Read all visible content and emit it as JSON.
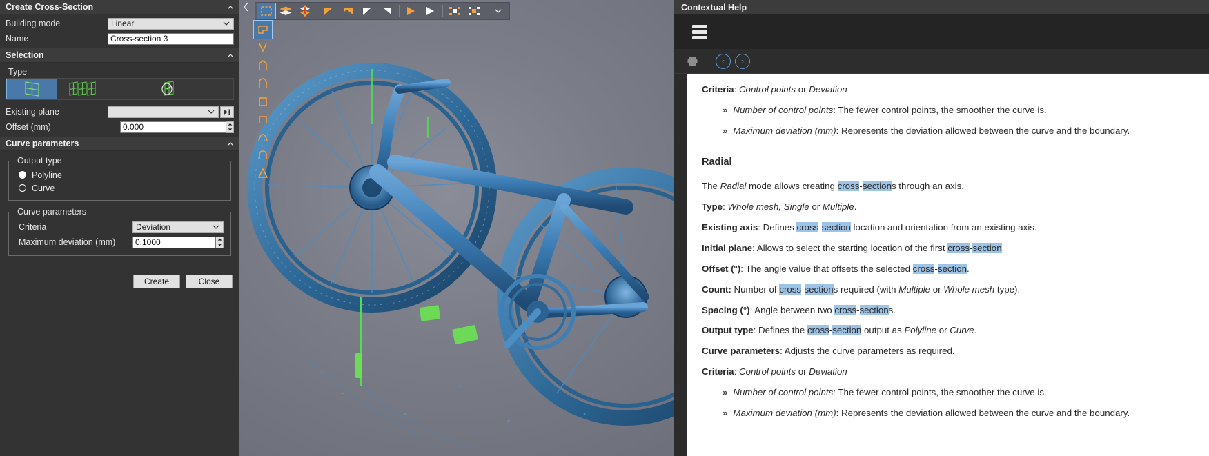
{
  "left_panel": {
    "title": "Create Cross-Section",
    "collapse_icon": "chevron-up-icon",
    "building_mode": {
      "label": "Building mode",
      "value": "Linear"
    },
    "name": {
      "label": "Name",
      "value": "Cross-section 3"
    },
    "selection": {
      "title": "Selection",
      "type_label": "Type"
    },
    "type_buttons": [
      {
        "name": "single-plane",
        "selected": true
      },
      {
        "name": "multiple-planes",
        "selected": false
      },
      {
        "name": "radial-planes",
        "selected": false
      }
    ],
    "existing_plane": {
      "label": "Existing plane",
      "value": ""
    },
    "offset": {
      "label": "Offset (mm)",
      "value": "0.000"
    },
    "curve_parameters_header": "Curve parameters",
    "output_type": {
      "title": "Output type",
      "options": [
        {
          "label": "Polyline",
          "selected": true
        },
        {
          "label": "Curve",
          "selected": false
        }
      ]
    },
    "curve_parameters_group": {
      "title": "Curve parameters",
      "criteria": {
        "label": "Criteria",
        "value": "Deviation"
      },
      "max_deviation": {
        "label": "Maximum deviation (mm)",
        "value": "0.1000"
      }
    },
    "buttons": {
      "create": "Create",
      "close": "Close"
    }
  },
  "viewport": {
    "collapse_icon": "chevron-left-icon",
    "top_toolbar": [
      {
        "name": "selection-rectangle-icon",
        "active": true
      },
      {
        "name": "layers-icon",
        "active": false
      },
      {
        "name": "diamond-stack-icon",
        "active": false
      },
      {
        "name": "arrow-left-triangle-icon",
        "active": false
      },
      {
        "name": "arrow-right-triangle-icon",
        "active": false
      },
      {
        "name": "white-triangle-left-icon",
        "active": false
      },
      {
        "name": "white-triangle-right-icon",
        "active": false
      },
      {
        "name": "play-triangle-icon",
        "active": false
      },
      {
        "name": "grid-select-icon",
        "active": false
      },
      {
        "name": "grid-deselect-icon",
        "active": false
      },
      {
        "name": "toolbar-overflow-chevron-icon",
        "active": false
      }
    ],
    "side_toolbar": [
      {
        "name": "select-all-icon",
        "active": true
      },
      {
        "name": "lasso-v-icon",
        "active": false
      },
      {
        "name": "polygon-select-icon",
        "active": false
      },
      {
        "name": "rounded-rect-select-icon",
        "active": false
      },
      {
        "name": "rect-select-icon",
        "active": false
      },
      {
        "name": "rect-select-2-icon",
        "active": false
      },
      {
        "name": "free-curve-select-icon",
        "active": false
      },
      {
        "name": "arch-select-icon",
        "active": false
      },
      {
        "name": "triangle-select-icon",
        "active": false
      }
    ],
    "model": "bicycle-3d-scan-mesh"
  },
  "help_panel": {
    "title": "Contextual Help",
    "menu_icon": "hamburger-menu-icon",
    "toolbar": {
      "print_icon": "printer-icon",
      "back_icon": "back-circle-icon",
      "back_glyph": "‹",
      "forward_icon": "forward-circle-icon",
      "forward_glyph": "›"
    },
    "content": {
      "top_criteria_label": "Criteria",
      "top_criteria_value_a": "Control points",
      "top_criteria_or": " or ",
      "top_criteria_value_b": "Deviation",
      "bullet_glyph": "»",
      "bullet1_term": "Number of control points",
      "bullet1_text": ": The fewer control points, the smoother the curve is.",
      "bullet2_term": "Maximum deviation (mm)",
      "bullet2_text": ": Represents the deviation allowed between the curve and the boundary.",
      "heading": "Radial",
      "intro_a": "The ",
      "intro_mode": "Radial",
      "intro_b": " mode allows creating ",
      "hl_cross": "cross",
      "hl_dash": "-",
      "hl_section": "section",
      "intro_c": "s through an axis.",
      "type_label": "Type",
      "type_value": "Whole mesh, Single",
      "type_or": " or ",
      "type_value2": "Multiple",
      "existing_axis_label": "Existing axis",
      "existing_axis_text_a": ": Defines ",
      "existing_axis_text_b": " location and orientation from an existing axis.",
      "initial_plane_label": "Initial plane",
      "initial_plane_text_a": ": Allows to select the starting location of the first ",
      "initial_plane_text_b": ".",
      "offset_label": "Offset (°)",
      "offset_text_a": ": The angle value that offsets the selected ",
      "offset_text_b": ".",
      "count_label": "Count:",
      "count_text_a": " Number of ",
      "count_text_b": "s required (with ",
      "count_em1": "Multiple",
      "count_or": " or ",
      "count_em2": "Whole mesh",
      "count_text_c": " type).",
      "spacing_label": "Spacing (°)",
      "spacing_text_a": ": Angle between two ",
      "spacing_text_b": "s.",
      "output_type_label": "Output type",
      "output_type_text_a": ": Defines the ",
      "output_type_text_b": " output as ",
      "output_em1": "Polyline",
      "output_or": " or ",
      "output_em2": "Curve",
      "output_text_c": ".",
      "curve_params_label": "Curve parameters",
      "curve_params_text": ": Adjusts the curve parameters as required.",
      "criteria2_label": "Criteria",
      "criteria2_text_a": ": ",
      "criteria2_em1": "Control points",
      "criteria2_or": " or ",
      "criteria2_em2": "Deviation"
    }
  },
  "colors": {
    "panel_bg": "#333333",
    "header_bg": "#3c3c3c",
    "accent_blue": "#4a78a8",
    "highlight": "#9dc3e6",
    "help_link": "#5a9bd5",
    "mesh_blue": "#2f6a9e"
  }
}
